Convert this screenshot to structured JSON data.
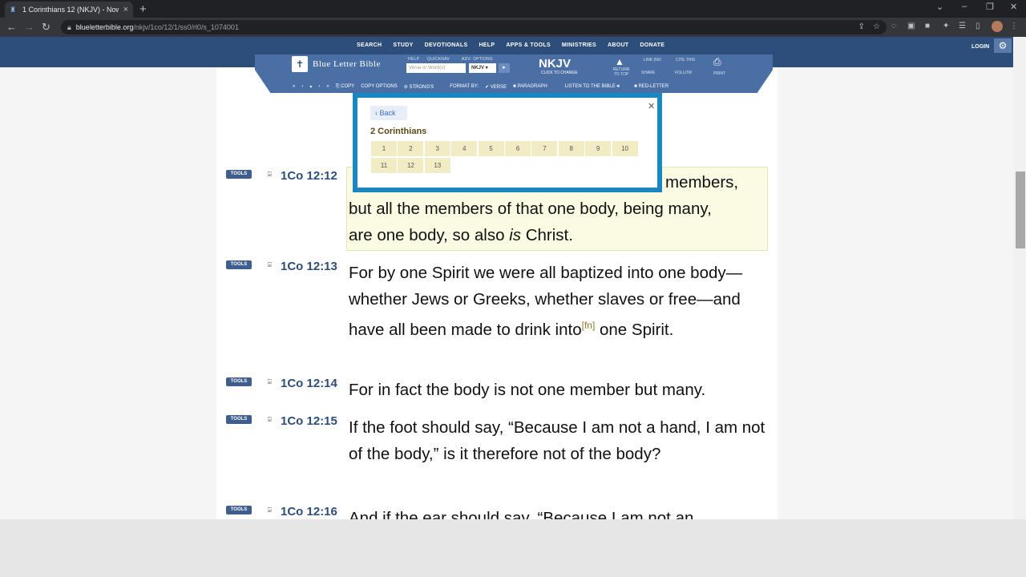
{
  "browser": {
    "tab_title": "1 Corinthians 12 (NKJV) - Now c",
    "url_host": "blueletterbible.org",
    "url_path": "/nkjv/1co/12/1/ss0/rl0/s_1074001"
  },
  "site": {
    "nav": [
      "SEARCH",
      "STUDY",
      "DEVOTIONALS",
      "HELP",
      "APPS & TOOLS",
      "MINISTRIES",
      "ABOUT",
      "DONATE"
    ],
    "login": "LOGIN",
    "logo": "Blue Letter Bible",
    "search_placeholder": "Verse or Word(s)",
    "version_select": "NKJV",
    "version_big": "NKJV",
    "version_sub": "CLICK TO CHANGE",
    "help_labels": [
      "HELP",
      "QUICKNAV",
      "ADV. OPTIONS"
    ],
    "return_top": "RETURN TO TOP",
    "link_cite": [
      "LINK (NO",
      "CITE THIS"
    ],
    "share_follow": [
      "SHARE",
      "FOLLOW"
    ],
    "print": "PRINT",
    "toolbar": {
      "copy": "COPY",
      "copy_options": "COPY OPTIONS",
      "strongs": "STRONG'S",
      "format_by": "FORMAT BY:",
      "verse": "VERSE",
      "paragraph": "PARAGRAPH",
      "listen": "LISTEN TO THE BIBLE",
      "red_letter": "RED-LETTER"
    }
  },
  "verses": [
    {
      "tools": "TOOLS",
      "ref": "1Co 12:12",
      "text_lines": [
        "members,",
        "but all the members of that one body, being many,",
        "are one body, so also",
        "is",
        " Christ."
      ]
    },
    {
      "tools": "TOOLS",
      "ref": "1Co 12:13",
      "text1": "For by one Spirit we were all baptized into one body—whether Jews or Greeks, whether slaves or free—and have all been made to drink into",
      "fn": "[fn]",
      "text2": "one Spirit."
    },
    {
      "tools": "TOOLS",
      "ref": "1Co 12:14",
      "text": "For in fact the body is not one member but many."
    },
    {
      "tools": "TOOLS",
      "ref": "1Co 12:15",
      "text": "If the foot should say, “Because I am not a hand, I am not of the body,” is it therefore not of the body?"
    },
    {
      "tools": "TOOLS",
      "ref": "1Co 12:16",
      "text": "And if the ear should say, “Because I am not an"
    }
  ],
  "popup": {
    "back": "Back",
    "book": "2 Corinthians",
    "chapters": [
      "1",
      "2",
      "3",
      "4",
      "5",
      "6",
      "7",
      "8",
      "9",
      "10",
      "11",
      "12",
      "13"
    ]
  }
}
